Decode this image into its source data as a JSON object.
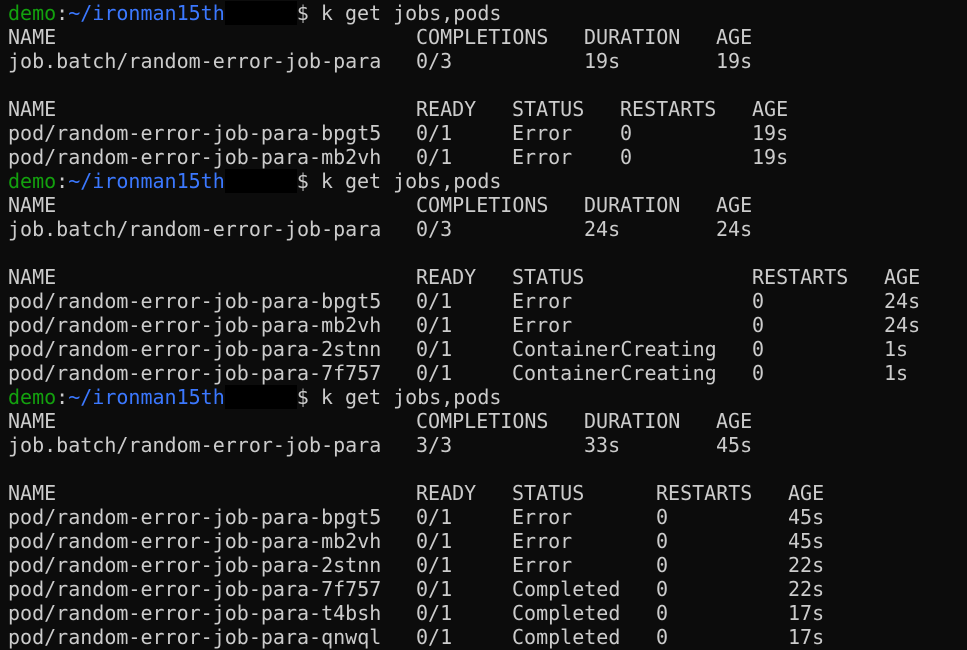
{
  "prompt": {
    "user": "demo",
    "separator": ":",
    "path": "~/ironman15th",
    "symbol": "$",
    "command": "k get jobs,pods"
  },
  "colors": {
    "background": "#0c0c0c",
    "text": "#cccccc",
    "user": "#13a10e",
    "path": "#3b78ff",
    "redaction": "#000000"
  },
  "blocks": [
    {
      "jobs": {
        "headers": [
          "NAME",
          "COMPLETIONS",
          "DURATION",
          "AGE"
        ],
        "rows": [
          [
            "job.batch/random-error-job-para",
            "0/3",
            "19s",
            "19s"
          ]
        ]
      },
      "pods": {
        "headers": [
          "NAME",
          "READY",
          "STATUS",
          "RESTARTS",
          "AGE"
        ],
        "rows": [
          [
            "pod/random-error-job-para-bpgt5",
            "0/1",
            "Error",
            "0",
            "19s"
          ],
          [
            "pod/random-error-job-para-mb2vh",
            "0/1",
            "Error",
            "0",
            "19s"
          ]
        ]
      }
    },
    {
      "jobs": {
        "headers": [
          "NAME",
          "COMPLETIONS",
          "DURATION",
          "AGE"
        ],
        "rows": [
          [
            "job.batch/random-error-job-para",
            "0/3",
            "24s",
            "24s"
          ]
        ]
      },
      "pods": {
        "headers": [
          "NAME",
          "READY",
          "STATUS",
          "RESTARTS",
          "AGE"
        ],
        "rows": [
          [
            "pod/random-error-job-para-bpgt5",
            "0/1",
            "Error",
            "0",
            "24s"
          ],
          [
            "pod/random-error-job-para-mb2vh",
            "0/1",
            "Error",
            "0",
            "24s"
          ],
          [
            "pod/random-error-job-para-2stnn",
            "0/1",
            "ContainerCreating",
            "0",
            "1s"
          ],
          [
            "pod/random-error-job-para-7f757",
            "0/1",
            "ContainerCreating",
            "0",
            "1s"
          ]
        ]
      }
    },
    {
      "jobs": {
        "headers": [
          "NAME",
          "COMPLETIONS",
          "DURATION",
          "AGE"
        ],
        "rows": [
          [
            "job.batch/random-error-job-para",
            "3/3",
            "33s",
            "45s"
          ]
        ]
      },
      "pods": {
        "headers": [
          "NAME",
          "READY",
          "STATUS",
          "RESTARTS",
          "AGE"
        ],
        "rows": [
          [
            "pod/random-error-job-para-bpgt5",
            "0/1",
            "Error",
            "0",
            "45s"
          ],
          [
            "pod/random-error-job-para-mb2vh",
            "0/1",
            "Error",
            "0",
            "45s"
          ],
          [
            "pod/random-error-job-para-2stnn",
            "0/1",
            "Error",
            "0",
            "22s"
          ],
          [
            "pod/random-error-job-para-7f757",
            "0/1",
            "Completed",
            "0",
            "22s"
          ],
          [
            "pod/random-error-job-para-t4bsh",
            "0/1",
            "Completed",
            "0",
            "17s"
          ],
          [
            "pod/random-error-job-para-qnwql",
            "0/1",
            "Completed",
            "0",
            "17s"
          ]
        ]
      }
    }
  ]
}
